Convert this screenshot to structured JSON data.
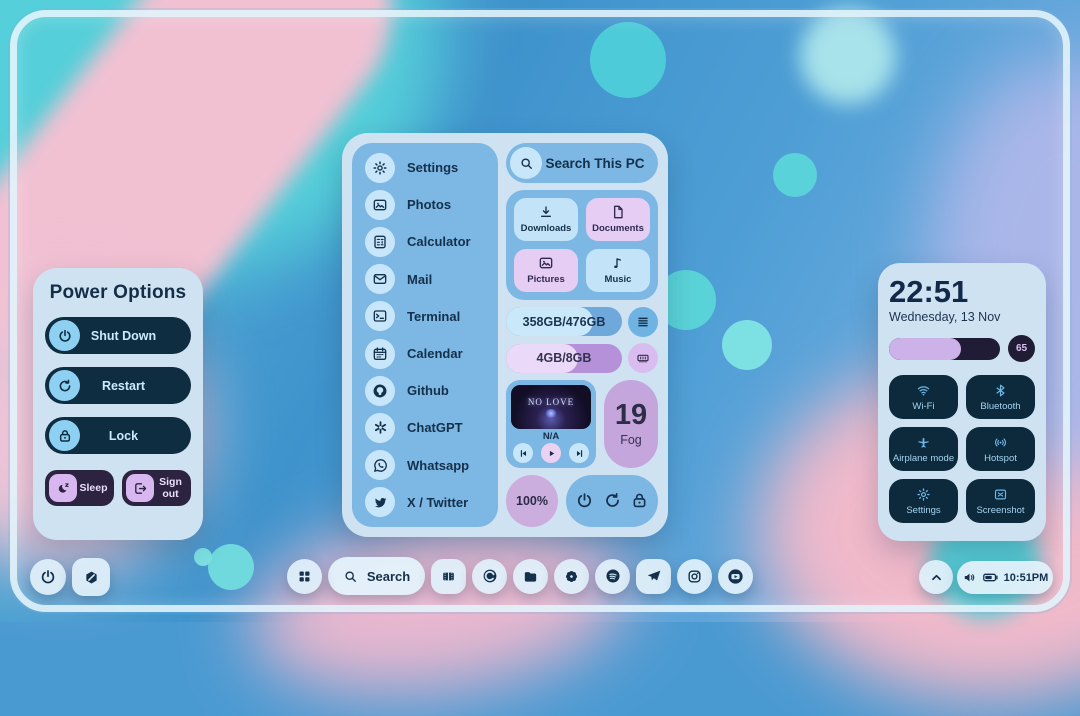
{
  "colors": {
    "accent_navy": "#14304a",
    "panel_light_blue": "#cfe2f2",
    "panel_medium_blue": "#7db7e4",
    "chip_pale_blue": "#c7e6f9",
    "tile_lavender": "#e6cdf4",
    "lavender_mid": "#c4a5dc",
    "dark_tile": "#0c2a3c",
    "dark_purple_button": "#2c2340",
    "battery_track": "#201c36",
    "battery_fill": "#cdb2ea"
  },
  "power_panel": {
    "title": "Power Options",
    "primary_buttons": [
      {
        "label": "Shut Down",
        "icon": "power-icon"
      },
      {
        "label": "Restart",
        "icon": "restart-icon"
      },
      {
        "label": "Lock",
        "icon": "lock-icon"
      }
    ],
    "secondary_buttons": [
      {
        "label": "Sleep",
        "icon": "sleep-icon"
      },
      {
        "label": "Sign out",
        "icon": "sign-out-icon"
      }
    ]
  },
  "app_menu": {
    "items": [
      {
        "label": "Settings",
        "icon": "gear-icon"
      },
      {
        "label": "Photos",
        "icon": "photo-icon"
      },
      {
        "label": "Calculator",
        "icon": "calculator-icon"
      },
      {
        "label": "Mail",
        "icon": "mail-icon"
      },
      {
        "label": "Terminal",
        "icon": "terminal-icon"
      },
      {
        "label": "Calendar",
        "icon": "calendar-icon"
      },
      {
        "label": "Github",
        "icon": "github-icon"
      },
      {
        "label": "ChatGPT",
        "icon": "chatgpt-icon"
      },
      {
        "label": "Whatsapp",
        "icon": "whatsapp-icon"
      },
      {
        "label": "X / Twitter",
        "icon": "twitter-icon"
      }
    ]
  },
  "control_center": {
    "search": {
      "label": "Search This PC",
      "icon": "search-icon"
    },
    "folders": [
      {
        "label": "Downloads",
        "icon": "download-icon",
        "tone": "blue"
      },
      {
        "label": "Documents",
        "icon": "document-icon",
        "tone": "purple"
      },
      {
        "label": "Pictures",
        "icon": "picture-icon",
        "tone": "purple"
      },
      {
        "label": "Music",
        "icon": "music-note-icon",
        "tone": "blue"
      }
    ],
    "storage": {
      "label": "358GB/476GB",
      "percent": 75,
      "icon": "drive-icon"
    },
    "memory": {
      "label": "4GB/8GB",
      "percent": 62,
      "icon": "ram-icon"
    },
    "music_player": {
      "album_art_text": "NO LOVE",
      "track_title": "N/A",
      "controls": [
        "previous-icon",
        "play-icon",
        "next-icon"
      ]
    },
    "weather": {
      "temperature": "19",
      "condition": "Fog"
    },
    "battery_label": "100%",
    "session_icons": [
      "power-icon",
      "restart-icon",
      "lock-icon"
    ]
  },
  "status_panel": {
    "time": "22:51",
    "date": "Wednesday, 13 Nov",
    "battery": {
      "percent": 65,
      "badge": "65"
    },
    "tiles": [
      {
        "label": "Wi-Fi",
        "icon": "wifi-icon"
      },
      {
        "label": "Bluetooth",
        "icon": "bluetooth-icon"
      },
      {
        "label": "Airplane mode",
        "icon": "airplane-icon"
      },
      {
        "label": "Hotspot",
        "icon": "hotspot-icon"
      },
      {
        "label": "Settings",
        "icon": "gear-icon"
      },
      {
        "label": "Screenshot",
        "icon": "screenshot-icon"
      }
    ]
  },
  "taskbar": {
    "left_icons": [
      "power-icon",
      "theme-toggle-icon"
    ],
    "dock_search_label": "Search",
    "dock_icons": [
      "app-grid-icon",
      "search-icon",
      "video-editor-icon",
      "browser-icon",
      "folder-icon",
      "flower-icon",
      "spotify-icon",
      "telegram-icon",
      "instagram-icon",
      "youtube-icon"
    ],
    "tray": {
      "chevron": "chevron-up-icon",
      "icons": [
        "speaker-icon",
        "battery-icon"
      ],
      "time": "10:51PM"
    }
  }
}
